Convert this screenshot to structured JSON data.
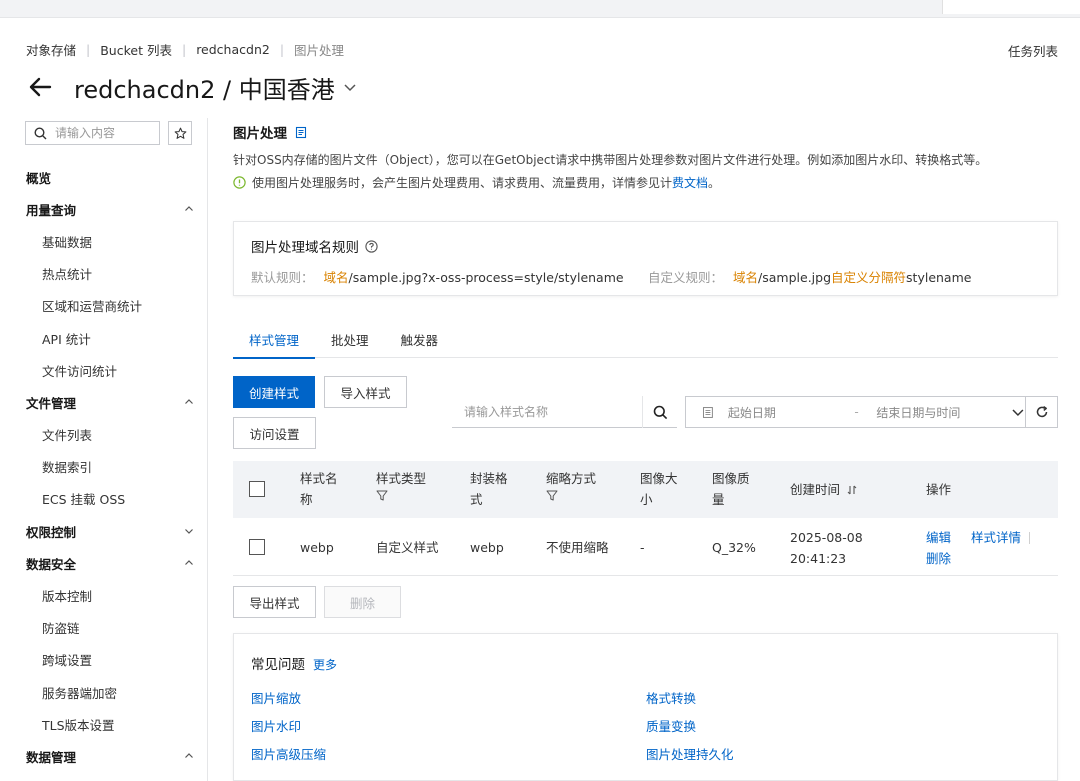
{
  "breadcrumb": [
    "对象存储",
    "Bucket 列表",
    "redchacdn2",
    "图片处理"
  ],
  "task_list": "任务列表",
  "page_title": "redchacdn2 / 中国香港",
  "sidebar": {
    "search_placeholder": "请输入内容",
    "items": [
      {
        "label": "概览",
        "level": "top"
      },
      {
        "label": "用量查询",
        "level": "top",
        "chevron": "up"
      },
      {
        "label": "基础数据",
        "level": "sub"
      },
      {
        "label": "热点统计",
        "level": "sub"
      },
      {
        "label": "区域和运营商统计",
        "level": "sub"
      },
      {
        "label": "API 统计",
        "level": "sub"
      },
      {
        "label": "文件访问统计",
        "level": "sub"
      },
      {
        "label": "文件管理",
        "level": "top",
        "chevron": "up"
      },
      {
        "label": "文件列表",
        "level": "sub"
      },
      {
        "label": "数据索引",
        "level": "sub"
      },
      {
        "label": "ECS 挂载 OSS",
        "level": "sub"
      },
      {
        "label": "权限控制",
        "level": "top",
        "chevron": "down"
      },
      {
        "label": "数据安全",
        "level": "top",
        "chevron": "up"
      },
      {
        "label": "版本控制",
        "level": "sub"
      },
      {
        "label": "防盗链",
        "level": "sub"
      },
      {
        "label": "跨域设置",
        "level": "sub"
      },
      {
        "label": "服务器端加密",
        "level": "sub"
      },
      {
        "label": "TLS版本设置",
        "level": "sub"
      },
      {
        "label": "数据管理",
        "level": "top",
        "chevron": "up"
      }
    ]
  },
  "main": {
    "title": "图片处理",
    "description": "针对OSS内存储的图片文件（Object），您可以在GetObject请求中携带图片处理参数对图片文件进行处理。例如添加图片水印、转换格式等。",
    "notice_prefix": "使用图片处理服务时，会产生图片处理费用、请求费用、流量费用，详情参见计",
    "notice_link": "费文档",
    "notice_suffix": "。",
    "rule_card": {
      "title": "图片处理域名规则",
      "default_label": "默认规则：",
      "default_domain": "域名",
      "default_rest": "/sample.jpg?x-oss-process=style/stylename",
      "custom_label": "自定义规则：",
      "custom_domain": "域名",
      "custom_mid": "/sample.jpg",
      "custom_sep": "自定义分隔符",
      "custom_rest": "stylename"
    },
    "tabs": [
      "样式管理",
      "批处理",
      "触发器"
    ],
    "buttons": {
      "create": "创建样式",
      "import": "导入样式",
      "access": "访问设置",
      "export": "导出样式",
      "delete": "删除"
    },
    "style_search_placeholder": "请输入样式名称",
    "date_start": "起始日期",
    "date_dash": "-",
    "date_end": "结束日期与时间",
    "table": {
      "headers": {
        "name_1": "样式名",
        "name_2": "称",
        "type": "样式类型",
        "format_1": "封装格",
        "format_2": "式",
        "scale": "缩略方式",
        "size_1": "图像大",
        "size_2": "小",
        "quality_1": "图像质",
        "quality_2": "量",
        "created": "创建时间",
        "ops": "操作"
      },
      "rows": [
        {
          "name": "webp",
          "type": "自定义样式",
          "format": "webp",
          "scale": "不使用缩略",
          "size": "-",
          "quality": "Q_32%",
          "created_date": "2025-08-08",
          "created_time": "20:41:23",
          "op_edit": "编辑",
          "op_detail": "样式详情",
          "op_delete": "删除"
        }
      ]
    },
    "faq": {
      "title": "常见问题",
      "more": "更多",
      "links": [
        "图片缩放",
        "格式转换",
        "图片水印",
        "质量变换",
        "图片高级压缩",
        "图片处理持久化"
      ]
    }
  },
  "colors": {
    "primary": "#0064c8",
    "highlight": "#d98200",
    "notice_icon": "#7cb82f"
  }
}
